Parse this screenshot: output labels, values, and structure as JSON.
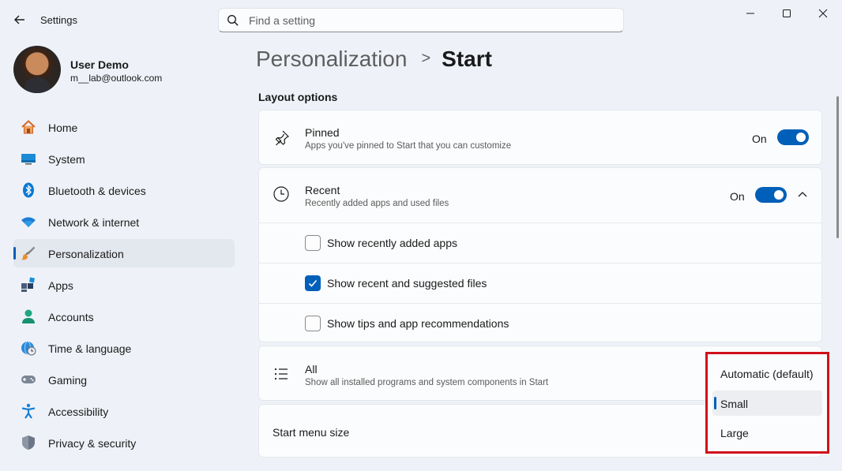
{
  "window": {
    "app_title": "Settings",
    "search_placeholder": "Find a setting"
  },
  "profile": {
    "name": "User Demo",
    "email": "m__lab@outlook.com"
  },
  "sidebar": {
    "items": [
      {
        "label": "Home",
        "icon": "home-icon",
        "active": false
      },
      {
        "label": "System",
        "icon": "system-icon",
        "active": false
      },
      {
        "label": "Bluetooth & devices",
        "icon": "bluetooth-icon",
        "active": false
      },
      {
        "label": "Network & internet",
        "icon": "wifi-icon",
        "active": false
      },
      {
        "label": "Personalization",
        "icon": "brush-icon",
        "active": true
      },
      {
        "label": "Apps",
        "icon": "apps-icon",
        "active": false
      },
      {
        "label": "Accounts",
        "icon": "person-icon",
        "active": false
      },
      {
        "label": "Time & language",
        "icon": "globe-clock-icon",
        "active": false
      },
      {
        "label": "Gaming",
        "icon": "gamepad-icon",
        "active": false
      },
      {
        "label": "Accessibility",
        "icon": "accessibility-icon",
        "active": false
      },
      {
        "label": "Privacy & security",
        "icon": "shield-icon",
        "active": false
      }
    ]
  },
  "header": {
    "parent": "Personalization",
    "separator": ">",
    "current": "Start"
  },
  "main": {
    "section_title": "Layout options",
    "pinned": {
      "title": "Pinned",
      "subtitle": "Apps you've pinned to Start that you can customize",
      "toggle_label": "On",
      "toggle_on": true
    },
    "recent": {
      "title": "Recent",
      "subtitle": "Recently added apps and used files",
      "toggle_label": "On",
      "toggle_on": true,
      "options": [
        {
          "label": "Show recently added apps",
          "checked": false
        },
        {
          "label": "Show recent and suggested files",
          "checked": true
        },
        {
          "label": "Show tips and app recommendations",
          "checked": false
        }
      ]
    },
    "all": {
      "title": "All",
      "subtitle": "Show all installed programs and system components in Start"
    },
    "size": {
      "title": "Start menu size"
    }
  },
  "dropdown": {
    "options": [
      "Automatic (default)",
      "Small",
      "Large"
    ],
    "selected": "Small",
    "highlight_color": "#d0111b"
  },
  "colors": {
    "accent": "#005fb8",
    "background": "#eef2f8",
    "card": "#fbfcfd"
  }
}
